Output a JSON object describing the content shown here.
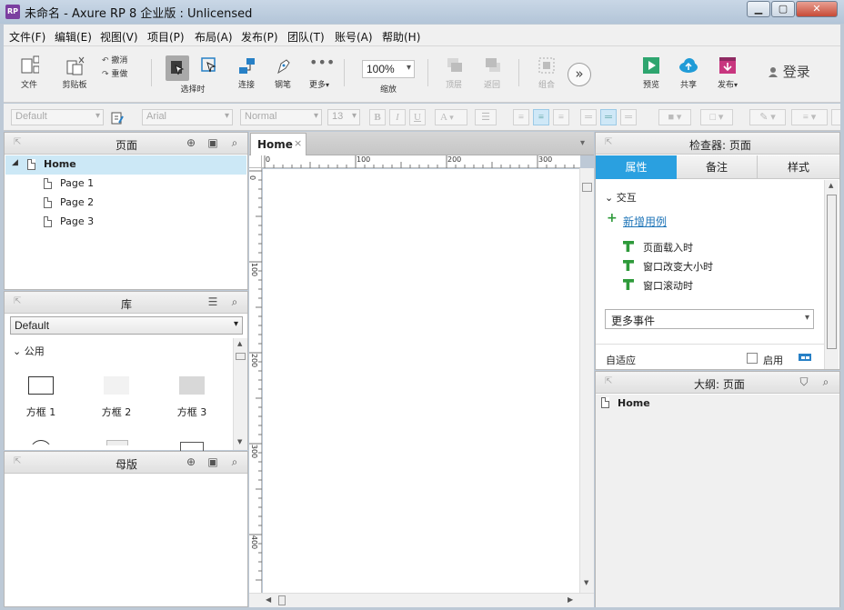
{
  "window": {
    "app_icon": "RP",
    "title": "未命名 - Axure RP 8 企业版 : Unlicensed"
  },
  "menu": [
    "文件(F)",
    "编辑(E)",
    "视图(V)",
    "项目(P)",
    "布局(A)",
    "发布(P)",
    "团队(T)",
    "账号(A)",
    "帮助(H)"
  ],
  "toolbar": {
    "file": "文件",
    "clipboard": "剪贴板",
    "undo": "撤消",
    "redo": "重做",
    "select_mode": "选择时",
    "connect": "连接",
    "pen": "钢笔",
    "more": "更多",
    "zoom_value": "100%",
    "zoom_label": "缩放",
    "top_layer": "顶层",
    "bottom_layer": "返回",
    "group": "组合",
    "preview": "预览",
    "share": "共享",
    "publish": "发布",
    "login": "登录"
  },
  "format": {
    "style": "Default",
    "font": "Arial",
    "weight": "Normal",
    "size": "13",
    "bold": "B",
    "italic": "I",
    "underline": "U",
    "text_color_icon": "A"
  },
  "pages_panel": {
    "title": "页面",
    "items": [
      "Home",
      "Page 1",
      "Page 2",
      "Page 3"
    ]
  },
  "library_panel": {
    "title": "库",
    "selected": "Default",
    "group": "公用",
    "widgets": [
      "方框 1",
      "方框 2",
      "方框 3"
    ]
  },
  "masters_panel": {
    "title": "母版"
  },
  "canvas": {
    "tab": "Home",
    "ruler_h": [
      "0",
      "100",
      "200",
      "300"
    ],
    "ruler_v": [
      "0",
      "100",
      "200",
      "300",
      "400"
    ]
  },
  "inspector": {
    "title": "检查器: 页面",
    "tabs": [
      "属性",
      "备注",
      "样式"
    ],
    "section": "交互",
    "add_case": "新增用例",
    "events": [
      "页面载入时",
      "窗口改变大小时",
      "窗口滚动时"
    ],
    "more_events": "更多事件",
    "adaptive": "自适应",
    "enable": "启用"
  },
  "outline": {
    "title": "大纲: 页面",
    "root": "Home"
  },
  "colors": {
    "accent": "#2aa0e0",
    "selected_row": "#cce8f6",
    "green": "#2e9a3a"
  }
}
